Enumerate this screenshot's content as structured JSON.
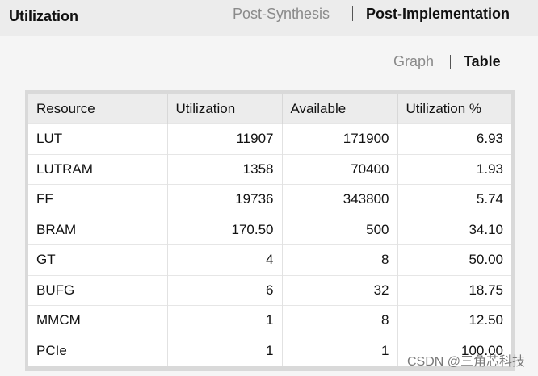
{
  "header": {
    "title": "Utilization",
    "tabs": [
      {
        "label": "Post-Synthesis",
        "active": false
      },
      {
        "label": "Post-Implementation",
        "active": true
      }
    ]
  },
  "view_tabs": [
    {
      "label": "Graph",
      "active": false
    },
    {
      "label": "Table",
      "active": true
    }
  ],
  "table": {
    "columns": [
      "Resource",
      "Utilization",
      "Available",
      "Utilization %"
    ],
    "rows": [
      [
        "LUT",
        "11907",
        "171900",
        "6.93"
      ],
      [
        "LUTRAM",
        "1358",
        "70400",
        "1.93"
      ],
      [
        "FF",
        "19736",
        "343800",
        "5.74"
      ],
      [
        "BRAM",
        "170.50",
        "500",
        "34.10"
      ],
      [
        "GT",
        "4",
        "8",
        "50.00"
      ],
      [
        "BUFG",
        "6",
        "32",
        "18.75"
      ],
      [
        "MMCM",
        "1",
        "8",
        "12.50"
      ],
      [
        "PCIe",
        "1",
        "1",
        "100.00"
      ]
    ]
  },
  "watermark": "CSDN @三角芯科技"
}
